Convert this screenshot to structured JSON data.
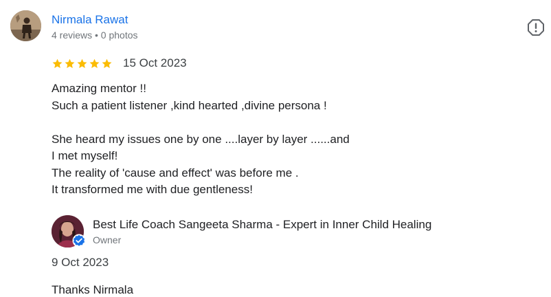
{
  "reviewer": {
    "name": "Nirmala Rawat",
    "meta": "4 reviews • 0 photos",
    "avatar_icon": "reviewer-photo"
  },
  "review": {
    "rating": 5,
    "rating_max": 5,
    "date": "15 Oct 2023",
    "lines": [
      "Amazing mentor !!",
      "Such a patient listener ,kind hearted ,divine persona !",
      "",
      "She heard my issues one by one ....layer by layer ......and",
      "I met myself!",
      "The reality of 'cause and effect' was before me .",
      "It transformed me with due gentleness!"
    ]
  },
  "report": {
    "icon": "report-icon"
  },
  "owner_reply": {
    "name": "Best Life Coach Sangeeta Sharma - Expert in Inner Child Healing",
    "role": "Owner",
    "date": "9 Oct 2023",
    "text": "Thanks Nirmala",
    "verified_icon": "verified-badge-icon"
  },
  "colors": {
    "link": "#1a73e8",
    "star": "#fbbc04",
    "muted": "#70757a",
    "verified": "#1a73e8"
  }
}
